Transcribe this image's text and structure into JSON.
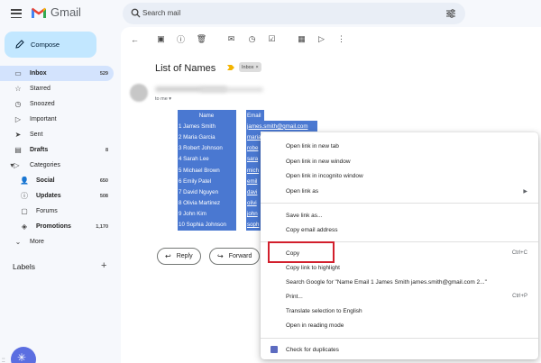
{
  "app": {
    "name": "Gmail"
  },
  "search": {
    "placeholder": "Search mail"
  },
  "compose": {
    "label": "Compose"
  },
  "nav": [
    {
      "label": "Inbox",
      "count": "529",
      "icon": "inbox-icon",
      "active": true,
      "bold": true
    },
    {
      "label": "Starred",
      "count": "",
      "icon": "star-icon"
    },
    {
      "label": "Snoozed",
      "count": "",
      "icon": "clock-icon"
    },
    {
      "label": "Important",
      "count": "",
      "icon": "important-icon"
    },
    {
      "label": "Sent",
      "count": "",
      "icon": "send-icon"
    },
    {
      "label": "Drafts",
      "count": "8",
      "icon": "draft-icon",
      "bold": true
    },
    {
      "label": "Categories",
      "count": "",
      "icon": "label-icon"
    },
    {
      "label": "Social",
      "count": "650",
      "icon": "people-icon",
      "bold": true,
      "sub": true
    },
    {
      "label": "Updates",
      "count": "508",
      "icon": "info-icon",
      "bold": true,
      "sub": true
    },
    {
      "label": "Forums",
      "count": "",
      "icon": "forum-icon",
      "sub": true
    },
    {
      "label": "Promotions",
      "count": "1,170",
      "icon": "tag-icon",
      "bold": true,
      "sub": true
    },
    {
      "label": "More",
      "count": "",
      "icon": "chevron-down-icon"
    }
  ],
  "labels": {
    "heading": "Labels",
    "add": "+"
  },
  "email": {
    "subject": "List of Names",
    "chip": "Inbox",
    "chip_close": "×",
    "to": "to me ▾"
  },
  "table": {
    "name_header": "Name",
    "email_header": "Email",
    "names": [
      "1 James Smith",
      "2 Maria Garcia",
      "3 Robert Johnson",
      "4 Sarah Lee",
      "5 Michael Brown",
      "6 Emily Patel",
      "7 David Nguyen",
      "8 Olivia Martinez",
      "9 John Kim",
      "10 Sophia Johnson"
    ],
    "emails": [
      "james.smith@gmail.com",
      "maria",
      "robe",
      "sara",
      "mich",
      "emil",
      "davi",
      "olivi",
      "john",
      "soph"
    ]
  },
  "actions": {
    "reply": "Reply",
    "forward": "Forward"
  },
  "context_menu": {
    "open_new_tab": "Open link in new tab",
    "open_new_window": "Open link in new window",
    "open_incognito": "Open link in incognito window",
    "open_link_as": "Open link as",
    "save_link_as": "Save link as...",
    "copy_email": "Copy email address",
    "copy": "Copy",
    "copy_shortcut": "Ctrl+C",
    "copy_link_highlight": "Copy link to highlight",
    "search_google": "Search Google for \"Name  Email 1 James Smith james.smith@gmail.com 2...\"",
    "print": "Print...",
    "print_shortcut": "Ctrl+P",
    "translate": "Translate selection to English",
    "reading_mode": "Open in reading mode",
    "check_duplicates": "Check for duplicates"
  },
  "colors": {
    "selection": "#4a78d1",
    "highlight_box": "#d21f2c",
    "compose_bg": "#c2e7ff"
  }
}
